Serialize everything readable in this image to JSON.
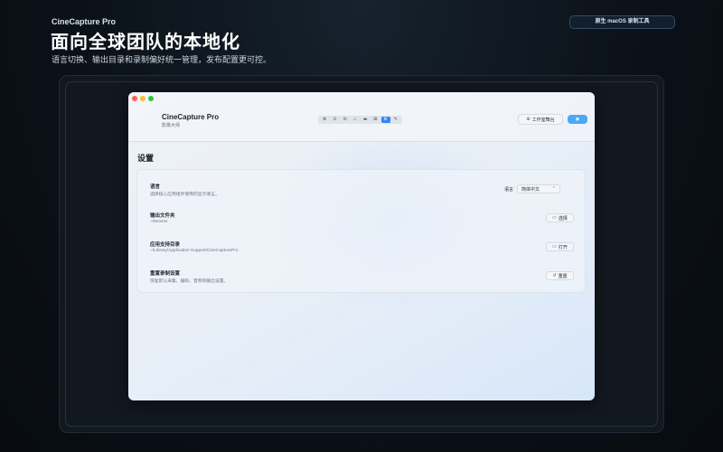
{
  "promo": {
    "app_name": "CineCapture Pro",
    "headline": "面向全球团队的本地化",
    "subtitle": "语言切换、输出目录和录制偏好统一管理，发布配置更可控。",
    "badge": "原生 macOS 录制工具"
  },
  "window": {
    "brand_name": "CineCapture Pro",
    "brand_sub": "影像大师",
    "toolbar": {
      "tools": [
        {
          "icon": "⊗"
        },
        {
          "icon": "⊙"
        },
        {
          "icon": "⊘"
        },
        {
          "icon": "⌂"
        },
        {
          "icon": "◂▸"
        },
        {
          "icon": "⊞"
        },
        {
          "icon": "⚙"
        },
        {
          "icon": "✎"
        }
      ],
      "active_index": 6
    },
    "workspace_button": "工作室舞台",
    "workspace_icon": "⊕",
    "primary_icon": "◉"
  },
  "settings": {
    "title": "设置",
    "rows": [
      {
        "title": "语言",
        "desc": "选择核心应用组件使用的显示语言。",
        "label": "语言",
        "select_value": "简体中文",
        "select_icon": "⌃"
      },
      {
        "title": "输出文件夹",
        "desc": "~/Movies",
        "button": "选择",
        "button_icon": "▭"
      },
      {
        "title": "应用支持目录",
        "desc": "~/Library/Application Support/CineCapturePro",
        "button": "打开",
        "button_icon": "▭"
      },
      {
        "title": "重置录制设置",
        "desc": "恢复默认采集、编码、音频和输出设置。",
        "button": "重置",
        "button_icon": "↺"
      }
    ]
  }
}
